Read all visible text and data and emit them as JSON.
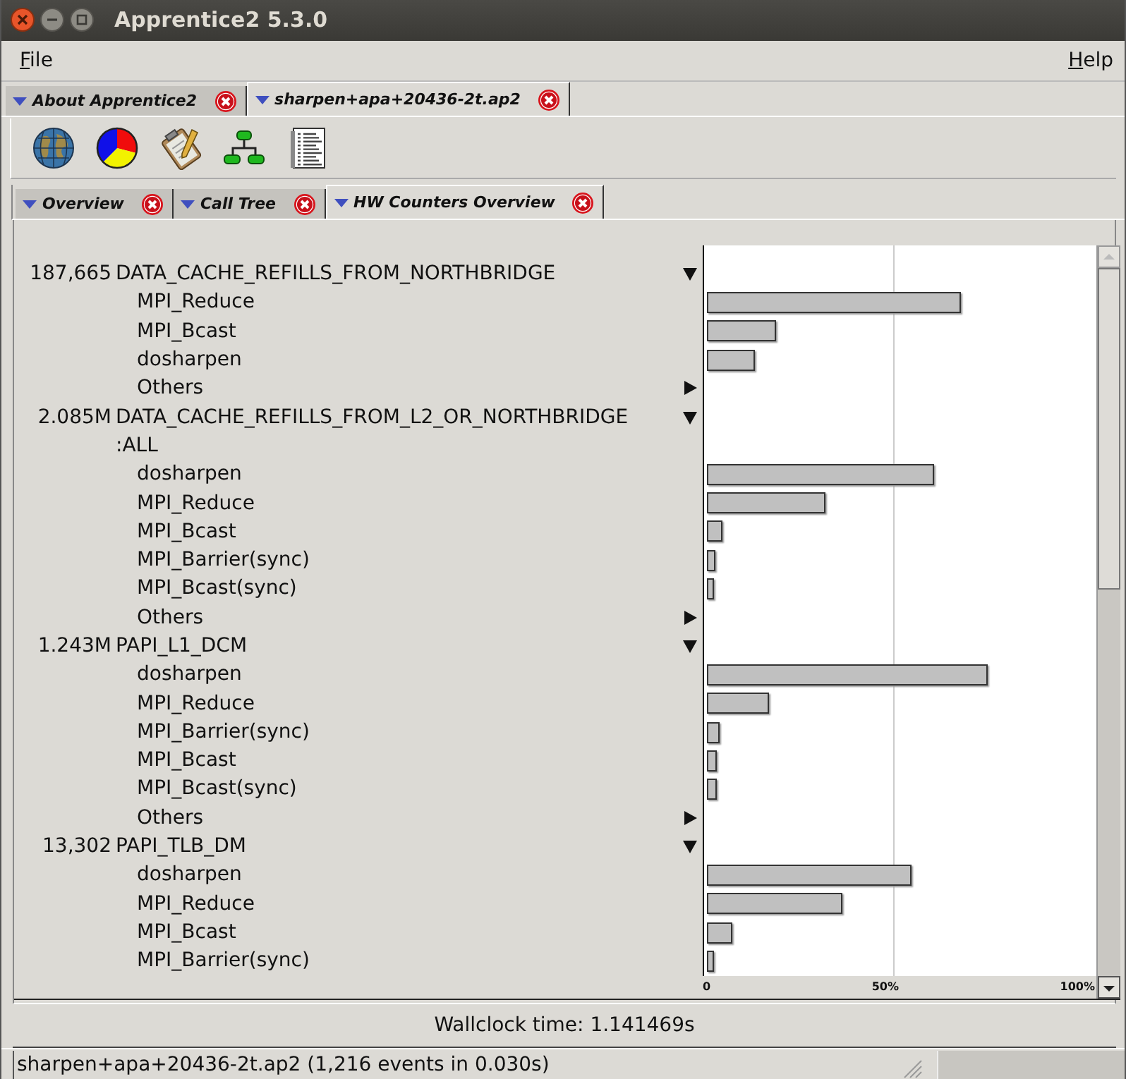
{
  "window": {
    "title": "Apprentice2 5.3.0"
  },
  "menu": [
    {
      "label": "File"
    },
    {
      "label": "Help"
    }
  ],
  "document_tabs": [
    {
      "label": "About Apprentice2",
      "selected": false
    },
    {
      "label": "sharpen+apa+20436-2t.ap2",
      "selected": true
    }
  ],
  "view_tabs": [
    {
      "label": "Overview",
      "selected": false
    },
    {
      "label": "Call Tree",
      "selected": false
    },
    {
      "label": "HW Counters Overview",
      "selected": true
    }
  ],
  "counters": [
    {
      "value": "187,665",
      "name": "DATA_CACHE_REFILLS_FROM_NORTHBRIDGE",
      "expanded": true,
      "children": [
        {
          "kind": "function",
          "name": "MPI_Reduce",
          "level": 0.68
        },
        {
          "kind": "function",
          "name": "MPI_Bcast",
          "level": 0.185
        },
        {
          "kind": "function",
          "name": "dosharpen",
          "level": 0.13
        },
        {
          "kind": "group",
          "name": "Others",
          "expanded": false
        }
      ]
    },
    {
      "value": "2.085M",
      "name": "DATA_CACHE_REFILLS_FROM_L2_OR_NORTHBRIDGE:ALL",
      "expanded": true,
      "children": [
        {
          "kind": "function",
          "name": "dosharpen",
          "level": 0.61
        },
        {
          "kind": "function",
          "name": "MPI_Reduce",
          "level": 0.32
        },
        {
          "kind": "function",
          "name": "MPI_Bcast",
          "level": 0.042
        },
        {
          "kind": "function",
          "name": "MPI_Barrier(sync)",
          "level": 0.022
        },
        {
          "kind": "function",
          "name": "MPI_Bcast(sync)",
          "level": 0.018
        },
        {
          "kind": "group",
          "name": "Others",
          "expanded": false
        }
      ]
    },
    {
      "value": "1.243M",
      "name": "PAPI_L1_DCM",
      "expanded": true,
      "children": [
        {
          "kind": "function",
          "name": "dosharpen",
          "level": 0.755
        },
        {
          "kind": "function",
          "name": "MPI_Reduce",
          "level": 0.165
        },
        {
          "kind": "function",
          "name": "MPI_Barrier(sync)",
          "level": 0.035
        },
        {
          "kind": "function",
          "name": "MPI_Bcast",
          "level": 0.027
        },
        {
          "kind": "function",
          "name": "MPI_Bcast(sync)",
          "level": 0.027
        },
        {
          "kind": "group",
          "name": "Others",
          "expanded": false
        }
      ]
    },
    {
      "value": "13,302",
      "name": "PAPI_TLB_DM",
      "expanded": true,
      "children": [
        {
          "kind": "function",
          "name": "dosharpen",
          "level": 0.55
        },
        {
          "kind": "function",
          "name": "MPI_Reduce",
          "level": 0.365
        },
        {
          "kind": "function",
          "name": "MPI_Bcast",
          "level": 0.07
        },
        {
          "kind": "function",
          "name": "MPI_Barrier(sync)",
          "level": 0.018
        }
      ]
    }
  ],
  "axis_ticks": [
    "0",
    "50%",
    "100%"
  ],
  "wallclock": "Wallclock time: 1.141469s",
  "status_bar": {
    "text": "sharpen+apa+20436-2t.ap2 (1,216 events in 0.030s)"
  }
}
